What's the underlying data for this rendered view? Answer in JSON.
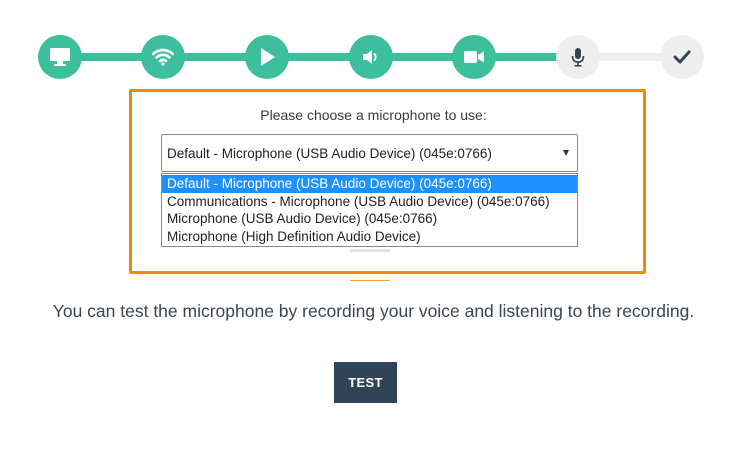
{
  "stepper": {
    "steps": [
      {
        "icon": "monitor-icon",
        "state": "done"
      },
      {
        "icon": "wifi-icon",
        "state": "done"
      },
      {
        "icon": "play-icon",
        "state": "done"
      },
      {
        "icon": "speaker-icon",
        "state": "done"
      },
      {
        "icon": "video-camera-icon",
        "state": "done"
      },
      {
        "icon": "microphone-icon",
        "state": "current"
      },
      {
        "icon": "checkmark-icon",
        "state": "todo"
      }
    ],
    "colors": {
      "done": "#3dbf9e",
      "pending": "#eeeeee",
      "current_icon": "#2f4457"
    }
  },
  "microphone_picker": {
    "prompt": "Please choose a microphone to use:",
    "selected_value": "Default - Microphone (USB Audio Device) (045e:0766)",
    "options": [
      "Default - Microphone (USB Audio Device) (045e:0766)",
      "Communications - Microphone (USB Audio Device) (045e:0766)",
      "Microphone (USB Audio Device) (045e:0766)",
      "Microphone (High Definition Audio Device)"
    ],
    "highlighted_option": 0,
    "highlight_border_color": "#f08a00",
    "option_highlight_color": "#1e90ff"
  },
  "description": "You can test the microphone by recording your voice and listening to the recording.",
  "test_button": {
    "label": "TEST",
    "color": "#2f4457"
  }
}
